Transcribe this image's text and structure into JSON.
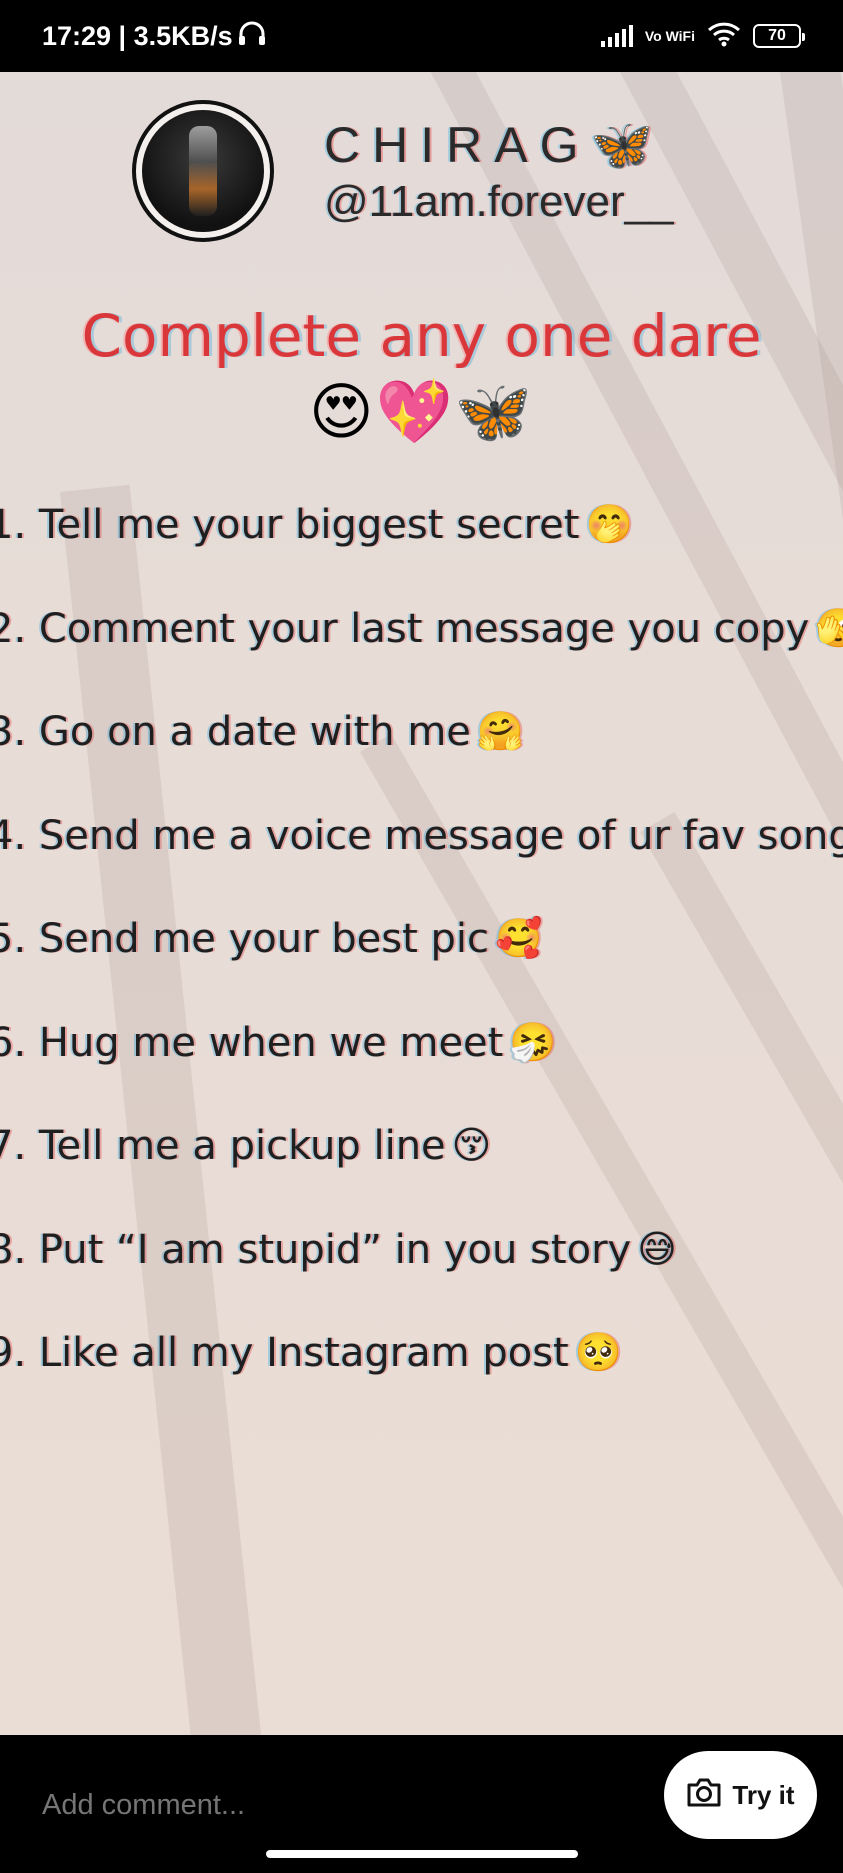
{
  "status_bar": {
    "time_speed": "17:29 | 3.5KB/s",
    "network": "Vo WiFi",
    "battery": "70"
  },
  "post": {
    "profile_name": "CHIRAG🦋",
    "profile_handle": "@11am.forever__",
    "headline": "Complete any one dare",
    "headline_emojis": "😍💖🦋",
    "dares": [
      {
        "text": "1. Tell me your biggest secret",
        "emoji": "🤭"
      },
      {
        "text": "2. Comment your last message you copy",
        "emoji": "🫣"
      },
      {
        "text": "3. Go on a date with me",
        "emoji": "🤗"
      },
      {
        "text": "4. Send me a voice message of ur fav song",
        "emoji": "😊"
      },
      {
        "text": "5. Send me your best pic",
        "emoji": "🥰"
      },
      {
        "text": "6. Hug me when we meet",
        "emoji": "🤧"
      },
      {
        "text": "7. Tell me a pickup line",
        "emoji": "😚"
      },
      {
        "text": "8. Put “I am stupid” in you story",
        "emoji": "😅"
      },
      {
        "text": "9. Like all my Instagram post",
        "emoji": "🥺"
      }
    ]
  },
  "bottom_bar": {
    "comment_placeholder": "Add comment...",
    "try_label": "Try it"
  }
}
